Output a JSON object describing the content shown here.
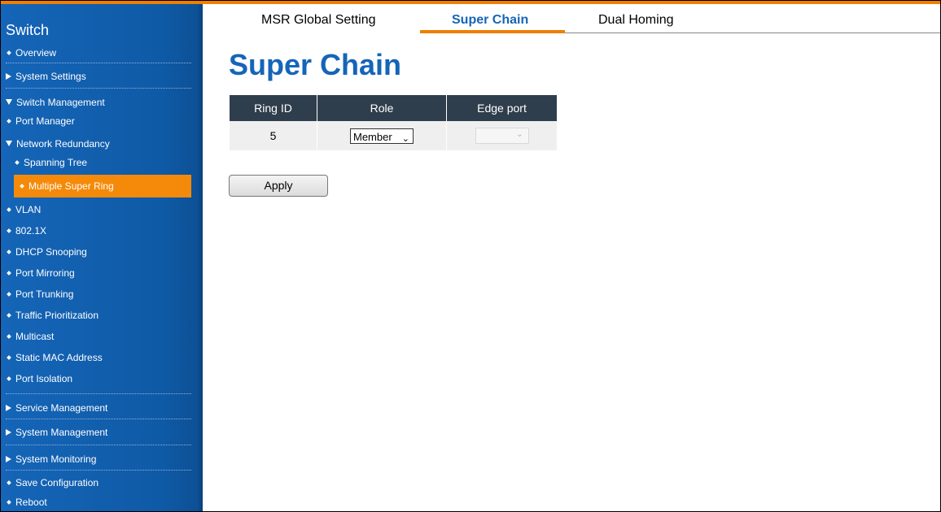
{
  "sidebar": {
    "title": "Switch",
    "items": {
      "overview": "Overview",
      "system_settings": "System Settings",
      "switch_management": "Switch Management",
      "port_manager": "Port Manager",
      "network_redundancy": "Network Redundancy",
      "spanning_tree": "Spanning Tree",
      "multiple_super_ring": "Multiple Super Ring",
      "vlan": "VLAN",
      "dot1x": "802.1X",
      "dhcp_snooping": "DHCP Snooping",
      "port_mirroring": "Port Mirroring",
      "port_trunking": "Port Trunking",
      "traffic_prioritization": "Traffic Prioritization",
      "multicast": "Multicast",
      "static_mac": "Static MAC Address",
      "port_isolation": "Port Isolation",
      "service_management": "Service Management",
      "system_management": "System Management",
      "system_monitoring": "System Monitoring",
      "save_configuration": "Save Configuration",
      "reboot": "Reboot"
    }
  },
  "tabs": {
    "msr_global": "MSR Global Setting",
    "super_chain": "Super Chain",
    "dual_homing": "Dual Homing"
  },
  "page_title": "Super Chain",
  "table": {
    "headers": {
      "ring_id": "Ring ID",
      "role": "Role",
      "edge_port": "Edge port"
    },
    "row": {
      "ring_id": "5",
      "role": "Member",
      "edge_port": ""
    }
  },
  "apply_label": "Apply",
  "colors": {
    "accent": "#f07e00",
    "brand": "#1565b8",
    "header": "#2f3e4c"
  }
}
